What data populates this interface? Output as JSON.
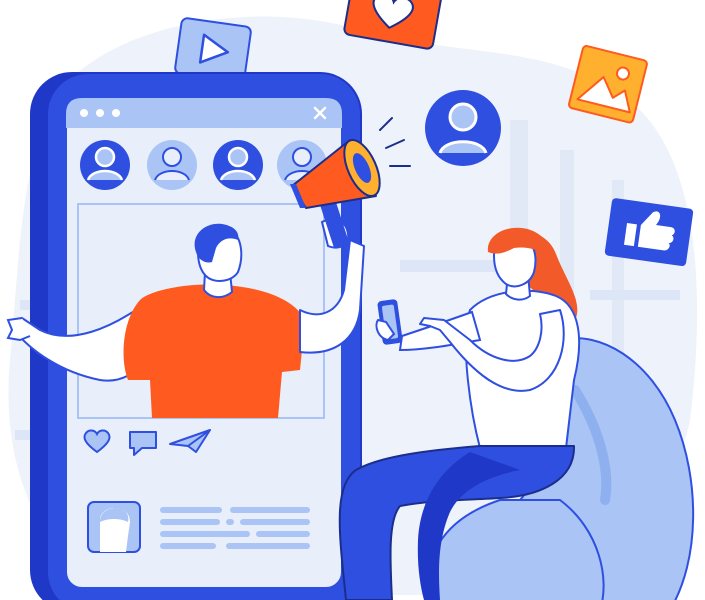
{
  "illustration": {
    "topic": "",
    "colors": {
      "primary_blue": "#2F4FE0",
      "phone_frame": "#2038C8",
      "screen_bg": "#E8EFFB",
      "light_blue": "#A9C4F5",
      "pale_bg": "#EEF3FB",
      "orange": "#FF5A1F",
      "hair_red": "#F25A2A",
      "yellow": "#FFB02E",
      "skin": "#FFFFFF",
      "outline": "#1C2E8C"
    },
    "floating_icons": [
      "play-icon",
      "heart-icon",
      "user-icon",
      "image-icon",
      "thumbs-up-icon"
    ],
    "screen_icons": [
      "like-icon",
      "comment-icon",
      "share-icon",
      "close-icon"
    ]
  }
}
